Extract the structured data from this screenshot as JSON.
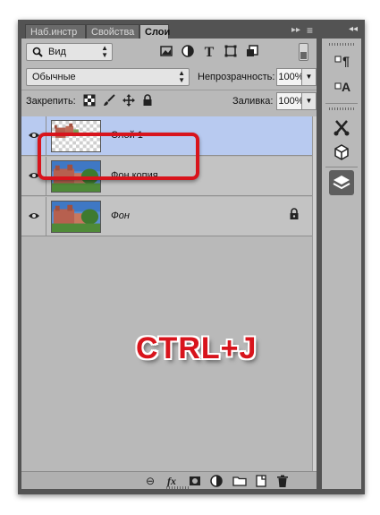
{
  "tabs": [
    {
      "label": "Наб.инстр",
      "active": false
    },
    {
      "label": "Свойства",
      "active": false
    },
    {
      "label": "Слои",
      "active": true
    }
  ],
  "filter": {
    "label": "Вид",
    "icons": [
      "image-filter-icon",
      "adjustment-filter-icon",
      "type-filter-icon",
      "shape-filter-icon",
      "smart-object-filter-icon"
    ]
  },
  "blend": {
    "mode": "Обычные",
    "opacity_label": "Непрозрачность:",
    "opacity_value": "100%"
  },
  "lock": {
    "label": "Закрепить:",
    "fill_label": "Заливка:",
    "fill_value": "100%"
  },
  "layers": [
    {
      "name": "Слой 1",
      "selected": true,
      "italic": false,
      "locked": false,
      "transparent": true
    },
    {
      "name": "Фон копия",
      "selected": false,
      "italic": false,
      "locked": false,
      "transparent": false
    },
    {
      "name": "Фон",
      "selected": false,
      "italic": true,
      "locked": true,
      "transparent": false
    }
  ],
  "annotation": {
    "shortcut": "CTRL+J"
  },
  "bottom_icons": [
    "link-layers-icon",
    "fx-icon",
    "mask-icon",
    "adjustment-layer-icon",
    "group-folder-icon",
    "new-layer-icon",
    "trash-icon"
  ],
  "dock_icons": [
    "paragraph-icon",
    "character-icon",
    "tool-presets-icon",
    "3d-icon",
    "layers-icon"
  ],
  "colors": {
    "accent_red": "#d8141c",
    "selected_layer": "#b8caf0",
    "panel_bg": "#b9b9b9"
  }
}
